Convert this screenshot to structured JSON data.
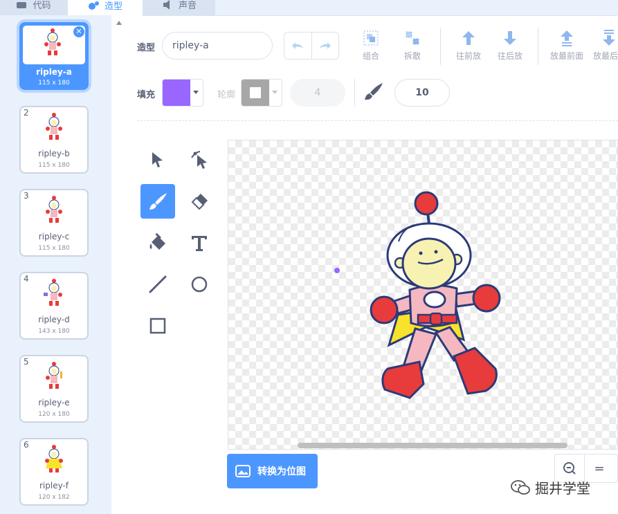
{
  "tabs": [
    {
      "label": "代码"
    },
    {
      "label": "造型"
    },
    {
      "label": "声音"
    }
  ],
  "costumes": [
    {
      "num": "1",
      "name": "ripley-a",
      "size": "115 x 180",
      "selected": true
    },
    {
      "num": "2",
      "name": "ripley-b",
      "size": "115 x 180"
    },
    {
      "num": "3",
      "name": "ripley-c",
      "size": "115 x 180"
    },
    {
      "num": "4",
      "name": "ripley-d",
      "size": "143 x 180"
    },
    {
      "num": "5",
      "name": "ripley-e",
      "size": "120 x 180"
    },
    {
      "num": "6",
      "name": "ripley-f",
      "size": "120 x 182"
    }
  ],
  "editor": {
    "costume_label": "造型",
    "costume_name": "ripley-a",
    "group_label": "组合",
    "ungroup_label": "拆散",
    "forward_label": "往前放",
    "backward_label": "往后放",
    "front_label": "放最前面",
    "back_label": "放最后",
    "fill_label": "填充",
    "fill_color": "#9966ff",
    "outline_label": "轮廓",
    "outline_width": "4",
    "brush_size": "10",
    "convert_label": "转换为位图",
    "zoom_reset": "="
  },
  "watermark": "掘井学堂",
  "colors": {
    "accent": "#4c97ff",
    "fill": "#9966ff",
    "outline_swatch": "#a7a7a7"
  }
}
